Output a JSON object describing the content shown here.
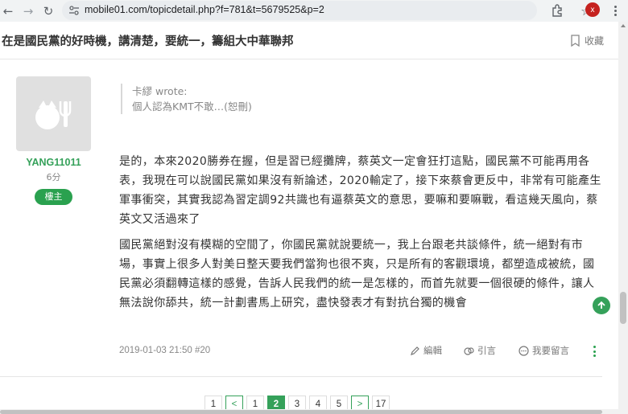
{
  "browser": {
    "url": "mobile01.com/topicdetail.php?f=781&t=5679525&p=2",
    "profile_initial": "x"
  },
  "topic": {
    "title": "在是國民黨的好時機，講清楚，要統一，籌組大中華聯邦",
    "bookmark_label": "收藏"
  },
  "post": {
    "author": {
      "username": "YANG11011",
      "score": "6分",
      "badge": "樓主"
    },
    "quote": {
      "author_line": "卡繆 wrote:",
      "text": "個人認為KMT不敢…(恕刪)"
    },
    "paragraphs": [
      "是的，本來2020勝券在握，但是習已經攤牌，蔡英文一定會狂打這點，國民黨不可能再用各表，我現在可以說國民黨如果沒有新論述，2020輸定了，接下來蔡會更反中，非常有可能產生軍事衝突，其實我認為習定調92共識也有逼蔡英文的意思，要嘛和要嘛戰，看這幾天風向，蔡英文又活過來了",
      "國民黨絕對沒有模糊的空間了，你國民黨就說要統一，我上台跟老共談條件，統一絕對有市場，事實上很多人對美日整天要我們當狗也很不爽，只是所有的客觀環境，都塑造成被統，國民黨必須翻轉這樣的感覺，告訴人民我們的統一是怎樣的，而首先就要一個很硬的條件，讓人無法說你舔共，統一計劃書馬上研究，盡快發表才有對抗台獨的機會"
    ],
    "meta": "2019-01-03 21:50 #20",
    "actions": {
      "edit": "編輯",
      "quote": "引言",
      "reply": "我要留言"
    }
  },
  "pagination": {
    "pages": [
      "1",
      "1",
      "2",
      "3",
      "4",
      "5",
      "17"
    ],
    "current": "2"
  },
  "colors": {
    "accent": "#35a15a",
    "badge": "#2aa14f"
  }
}
